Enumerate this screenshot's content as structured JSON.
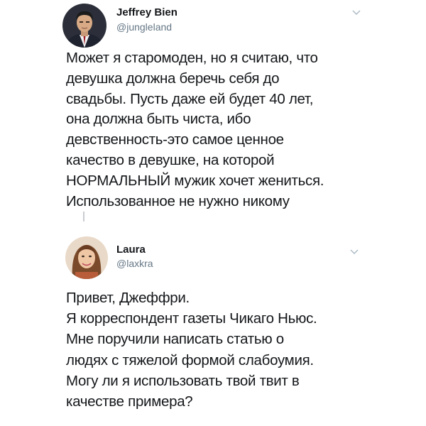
{
  "tweets": [
    {
      "author_name": "Jeffrey Bien",
      "author_handle": "@jungleland",
      "body": "Может я старомоден, но я считаю, что\nдевушка должна беречь себя до\nсвадьбы. Пусть даже ей будет 40 лет,\nона должна быть чиста, ибо\nдевственность-это самое ценное\nкачество в девушке, на которой\nНОРМАЛЬНЫЙ мужик хочет жениться.\nИспользованное не нужно никому",
      "avatar_icon": "user-avatar-photo",
      "menu_icon": "chevron-down-icon"
    },
    {
      "author_name": "Laura",
      "author_handle": "@laxkra",
      "body": "Привет, Джеффри.\nЯ корреспондент газеты Чикаго Ньюс.\nМне поручили написать статью о\nлюдях с тяжелой формой слабоумия.\nМогу ли я использовать твой твит в\nкачестве примера?",
      "avatar_icon": "user-avatar-photo",
      "menu_icon": "chevron-down-icon"
    }
  ],
  "colors": {
    "text": "#14171a",
    "secondary": "#657786",
    "background": "#ffffff"
  }
}
